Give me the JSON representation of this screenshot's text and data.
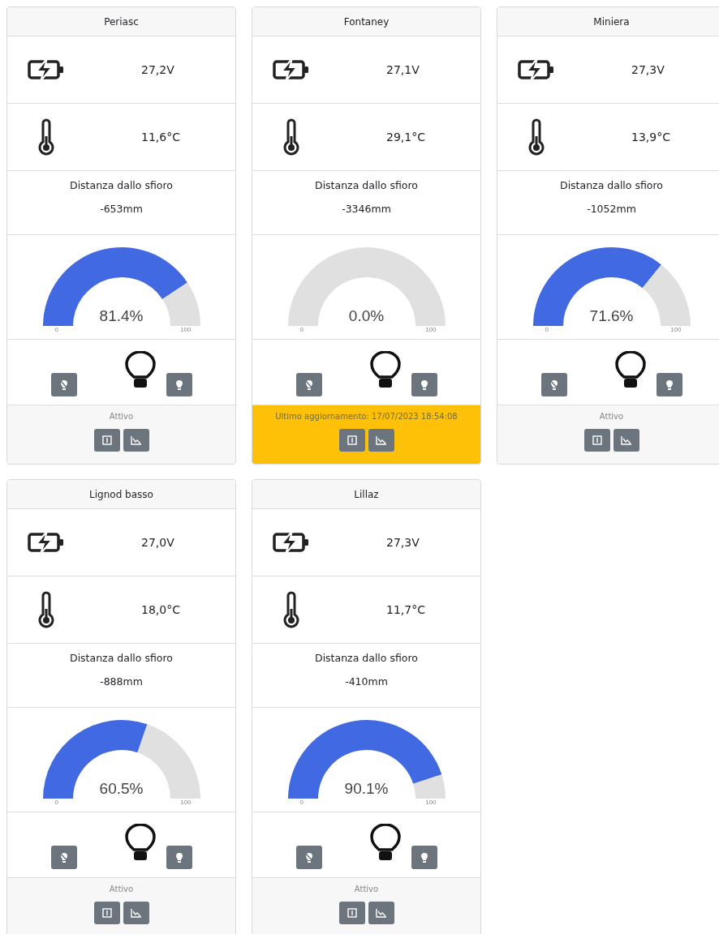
{
  "stations": [
    {
      "name": "Periasc",
      "voltage": "27,2V",
      "temperature": "11,6°C",
      "distance_label": "Distanza dallo sfioro",
      "distance": "-653mm",
      "gauge": {
        "reading": "81.4%",
        "min": "0",
        "max": "100"
      },
      "status": "Attivo",
      "warning": false
    },
    {
      "name": "Fontaney",
      "voltage": "27,1V",
      "temperature": "29,1°C",
      "distance_label": "Distanza dallo sfioro",
      "distance": "-3346mm",
      "gauge": {
        "reading": "0.0%",
        "min": "0",
        "max": "100"
      },
      "status": "Ultimo aggiornamento: 17/07/2023 18:54:08",
      "warning": true
    },
    {
      "name": "Miniera",
      "voltage": "27,3V",
      "temperature": "13,9°C",
      "distance_label": "Distanza dallo sfioro",
      "distance": "-1052mm",
      "gauge": {
        "reading": "71.6%",
        "min": "0",
        "max": "100"
      },
      "status": "Attivo",
      "warning": false
    },
    {
      "name": "Lignod basso",
      "voltage": "27,0V",
      "temperature": "18,0°C",
      "distance_label": "Distanza dallo sfioro",
      "distance": "-888mm",
      "gauge": {
        "reading": "60.5%",
        "min": "0",
        "max": "100"
      },
      "status": "Attivo",
      "warning": false
    },
    {
      "name": "Lillaz",
      "voltage": "27,3V",
      "temperature": "11,7°C",
      "distance_label": "Distanza dallo sfioro",
      "distance": "-410mm",
      "gauge": {
        "reading": "90.1%",
        "min": "0",
        "max": "100"
      },
      "status": "Attivo",
      "warning": false
    }
  ]
}
